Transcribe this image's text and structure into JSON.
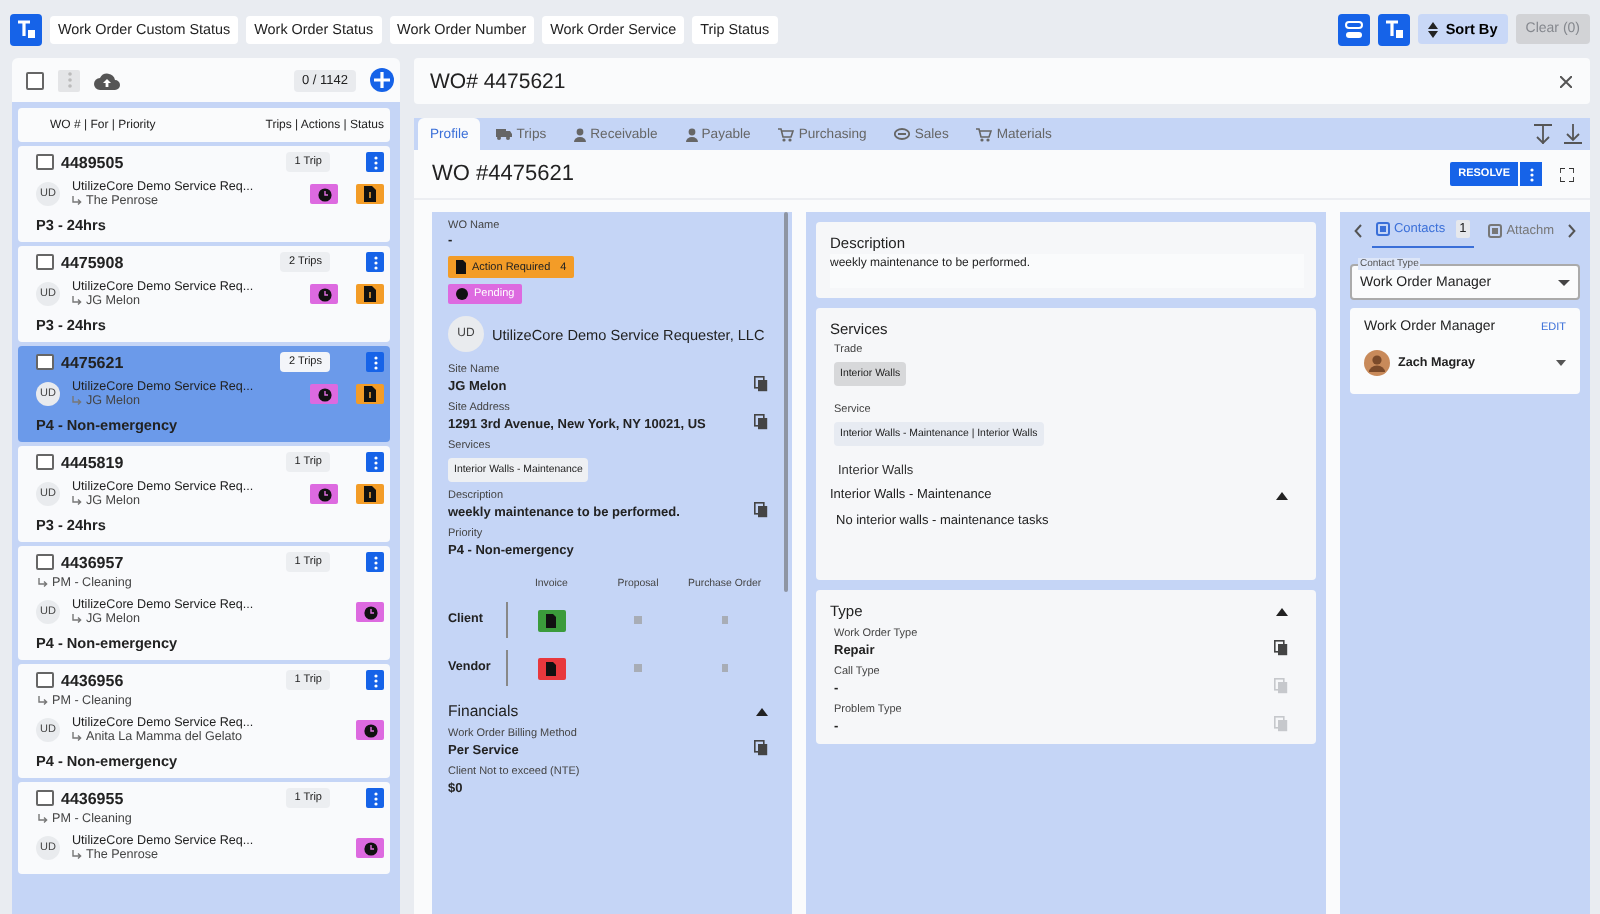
{
  "filters": {
    "chips": [
      "Work Order Custom Status",
      "Work Order Status",
      "Work Order Number",
      "Work Order Service",
      "Trip Status"
    ],
    "sort": "Sort By",
    "clear": {
      "label": "Clear (0)",
      "disabled": true
    }
  },
  "list": {
    "select_all": {
      "checked": false
    },
    "count": "0 / 1142",
    "header_left": "WO # | For | Priority",
    "header_right": "Trips | Actions | Status",
    "items": [
      {
        "number": "4489505",
        "avatar": "UD",
        "requester": "UtilizeCore Demo Service Req...",
        "site": "The Penrose",
        "priority": "P3 - 24hrs",
        "trips": "1 Trip",
        "statuses": [
          {
            "kind": "pending"
          },
          {
            "kind": "action"
          }
        ],
        "checked": false,
        "selected": false
      },
      {
        "number": "4475908",
        "avatar": "UD",
        "requester": "UtilizeCore Demo Service Req...",
        "site": "JG Melon",
        "priority": "P3 - 24hrs",
        "trips": "2 Trips",
        "statuses": [
          {
            "kind": "pending"
          },
          {
            "kind": "action"
          }
        ],
        "checked": false,
        "selected": false
      },
      {
        "number": "4475621",
        "avatar": "UD",
        "requester": "UtilizeCore Demo Service Req...",
        "site": "JG Melon",
        "priority": "P4 - Non-emergency",
        "trips": "2 Trips",
        "statuses": [
          {
            "kind": "pending"
          },
          {
            "kind": "action"
          }
        ],
        "checked": false,
        "selected": true
      },
      {
        "number": "4445819",
        "avatar": "UD",
        "requester": "UtilizeCore Demo Service Req...",
        "site": "JG Melon",
        "priority": "P3 - 24hrs",
        "trips": "1 Trip",
        "statuses": [
          {
            "kind": "pending"
          },
          {
            "kind": "action"
          }
        ],
        "checked": false,
        "selected": false
      },
      {
        "number": "4436957",
        "subtitle": "PM - Cleaning",
        "avatar": "UD",
        "requester": "UtilizeCore Demo Service Req...",
        "site": "JG Melon",
        "priority": "P4 - Non-emergency",
        "trips": "1 Trip",
        "statuses": [
          {
            "kind": "pending"
          }
        ],
        "checked": false,
        "selected": false
      },
      {
        "number": "4436956",
        "subtitle": "PM - Cleaning",
        "avatar": "UD",
        "requester": "UtilizeCore Demo Service Req...",
        "site": "Anita La Mamma del Gelato",
        "priority": "P4 - Non-emergency",
        "trips": "1 Trip",
        "statuses": [
          {
            "kind": "pending"
          }
        ],
        "checked": false,
        "selected": false
      },
      {
        "number": "4436955",
        "subtitle": "PM - Cleaning",
        "avatar": "UD",
        "requester": "UtilizeCore Demo Service Req...",
        "site": "The Penrose",
        "trips": "1 Trip",
        "statuses": [
          {
            "kind": "pending"
          }
        ],
        "checked": false,
        "selected": false
      }
    ]
  },
  "detail": {
    "title": "WO# 4475621",
    "tabs": [
      {
        "label": "Profile",
        "selected": true
      },
      {
        "label": "Trips",
        "selected": false
      },
      {
        "label": "Receivable",
        "selected": false
      },
      {
        "label": "Payable",
        "selected": false
      },
      {
        "label": "Purchasing",
        "selected": false
      },
      {
        "label": "Sales",
        "selected": false
      },
      {
        "label": "Materials",
        "selected": false
      }
    ],
    "heading": "WO #4475621",
    "resolve": "RESOLVE",
    "profile": {
      "wo_name_label": "WO Name",
      "wo_name": "-",
      "badges": [
        {
          "kind": "action",
          "label": "Action Required",
          "count": "4"
        },
        {
          "kind": "pending",
          "label": "Pending"
        }
      ],
      "requester_avatar": "UD",
      "requester": "UtilizeCore Demo Service Requester, LLC",
      "fields": [
        {
          "kind": "text",
          "label": "Site Name",
          "value": "JG Melon",
          "copyable": true
        },
        {
          "kind": "text",
          "label": "Site Address",
          "value": "1291 3rd Avenue, New York, NY 10021, US",
          "copyable": true
        },
        {
          "kind": "chip",
          "label": "Services",
          "value": "Interior Walls - Maintenance",
          "copyable": false
        },
        {
          "kind": "text",
          "label": "Description",
          "value": "weekly maintenance to be performed.",
          "copyable": true
        },
        {
          "kind": "text",
          "label": "Priority",
          "value": "P4 - Non-emergency",
          "copyable": false
        }
      ],
      "documents": {
        "columns": [
          "Invoice",
          "Proposal",
          "Purchase Order"
        ],
        "rows": [
          {
            "label": "Client",
            "cells": [
              {
                "kind": "paid"
              },
              {
                "kind": "none"
              },
              {
                "kind": "none"
              }
            ]
          },
          {
            "label": "Vendor",
            "cells": [
              {
                "kind": "unpaid"
              },
              {
                "kind": "none"
              },
              {
                "kind": "none"
              }
            ]
          }
        ]
      },
      "financials": {
        "title": "Financials",
        "expanded": true,
        "fields": [
          {
            "label": "Work Order Billing Method",
            "value": "Per Service",
            "copyable": true
          },
          {
            "label": "Client Not to exceed (NTE)",
            "value": "$0",
            "copyable": false
          }
        ]
      }
    },
    "description": {
      "title": "Description",
      "text": "weekly maintenance to be performed."
    },
    "services": {
      "title": "Services",
      "trade_label": "Trade",
      "trade": "Interior Walls",
      "service_label": "Service",
      "service": "Interior Walls - Maintenance | Interior Walls",
      "group": "Interior Walls",
      "subgroup": {
        "title": "Interior Walls - Maintenance",
        "expanded": true,
        "empty_text": "No interior walls - maintenance tasks"
      }
    },
    "type": {
      "title": "Type",
      "expanded": true,
      "fields": [
        {
          "label": "Work Order Type",
          "value": "Repair",
          "disabled": false
        },
        {
          "label": "Call Type",
          "value": "-",
          "disabled": true
        },
        {
          "label": "Problem Type",
          "value": "-",
          "disabled": true
        }
      ]
    },
    "side": {
      "tabs": [
        {
          "label": "Contacts",
          "count": "1",
          "selected": true
        },
        {
          "label": "Attachm",
          "selected": false
        }
      ],
      "contact_type": {
        "label": "Contact Type",
        "value": "Work Order Manager"
      },
      "group": {
        "title": "Work Order Manager",
        "action": "EDIT",
        "contacts": [
          {
            "name": "Zach Magray"
          }
        ]
      }
    }
  }
}
